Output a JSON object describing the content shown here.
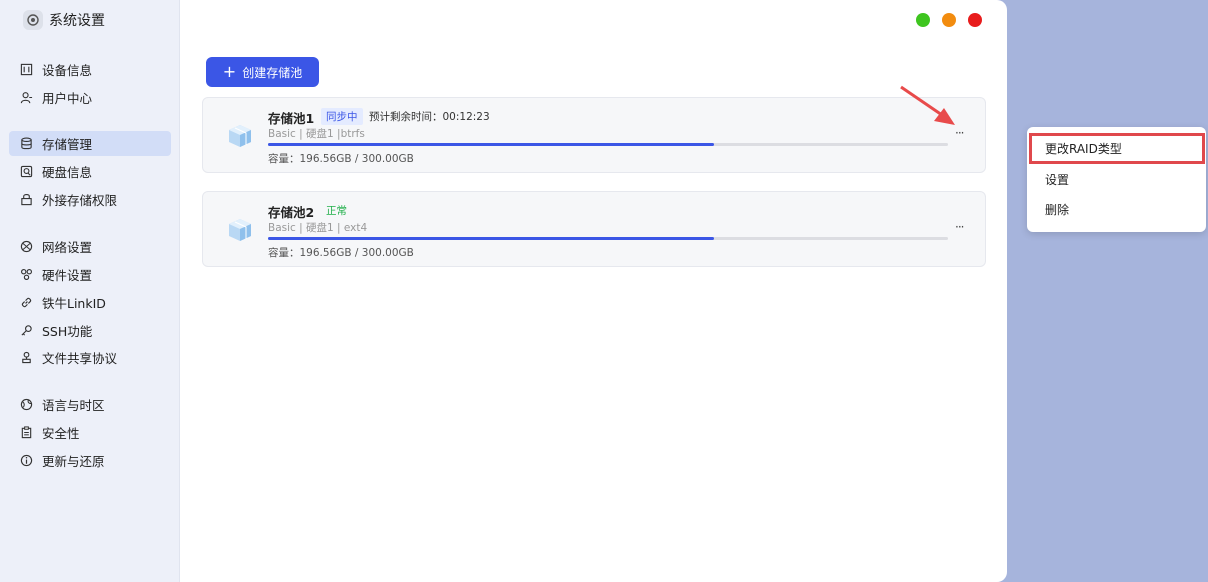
{
  "app": {
    "title": "系统设置"
  },
  "sidebar": {
    "items": [
      {
        "label": "设备信息",
        "icon": "device-info-icon"
      },
      {
        "label": "用户中心",
        "icon": "user-icon"
      },
      {
        "label": "存储管理",
        "icon": "database-icon",
        "active": true
      },
      {
        "label": "硬盘信息",
        "icon": "disk-icon"
      },
      {
        "label": "外接存储权限",
        "icon": "lock-icon"
      },
      {
        "label": "网络设置",
        "icon": "network-icon"
      },
      {
        "label": "硬件设置",
        "icon": "hardware-icon"
      },
      {
        "label": "铁牛LinkID",
        "icon": "link-icon"
      },
      {
        "label": "SSH功能",
        "icon": "key-icon"
      },
      {
        "label": "文件共享协议",
        "icon": "share-icon"
      },
      {
        "label": "语言与时区",
        "icon": "globe-icon"
      },
      {
        "label": "安全性",
        "icon": "clipboard-icon"
      },
      {
        "label": "更新与还原",
        "icon": "info-icon"
      }
    ]
  },
  "window_controls": {
    "colors": [
      "#3ec51f",
      "#f28c0f",
      "#e81c1c"
    ]
  },
  "toolbar": {
    "create_label": "创建存储池"
  },
  "pools": [
    {
      "name": "存储池1",
      "status": "同步中",
      "remaining_label": "预计剩余时间：",
      "remaining_time": "00:12:23",
      "meta": "Basic | 硬盘1 |btrfs",
      "capacity": "容量：196.56GB / 300.00GB",
      "used_fraction": 0.6552,
      "more": "···"
    },
    {
      "name": "存储池2",
      "status": "正常",
      "meta": "Basic | 硬盘1 | ext4",
      "capacity": "容量：196.56GB / 300.00GB",
      "used_fraction": 0.6552,
      "more": "···"
    }
  ],
  "context_menu": {
    "items": [
      "更改RAID类型",
      "设置",
      "删除"
    ]
  },
  "colors": {
    "accent": "#3b56e6",
    "highlight": "#e0484c",
    "ok": "#22b04b"
  }
}
